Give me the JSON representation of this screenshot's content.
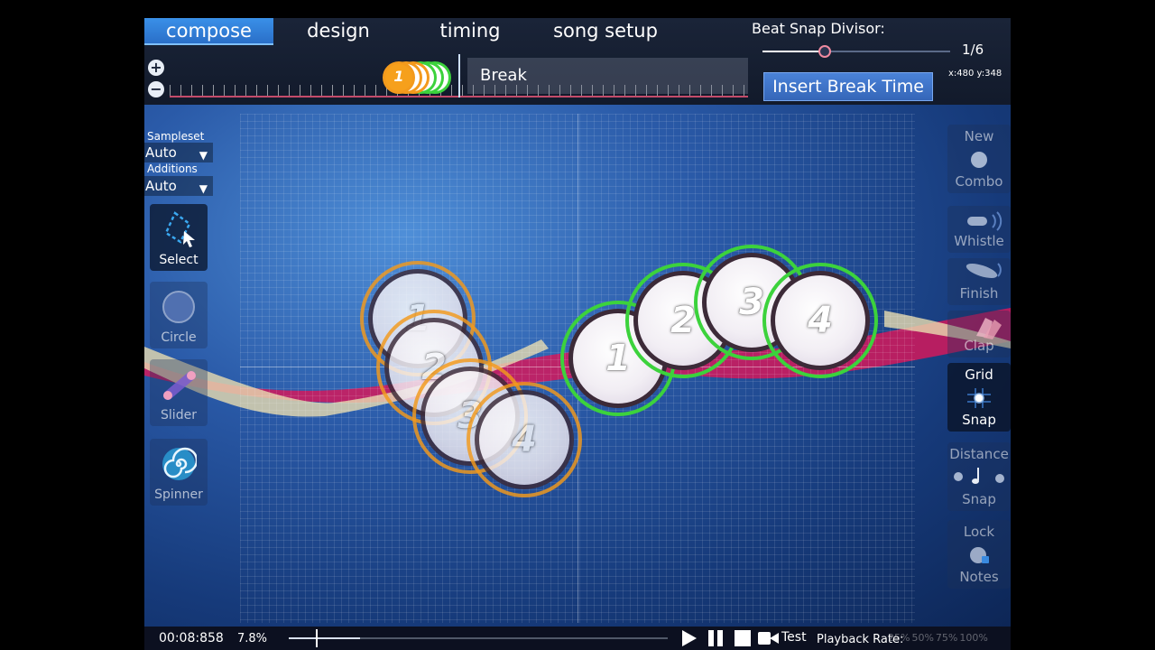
{
  "tabs": [
    {
      "label": "compose",
      "active": true
    },
    {
      "label": "design",
      "active": false
    },
    {
      "label": "timing",
      "active": false
    },
    {
      "label": "song setup",
      "active": false
    }
  ],
  "zoom": {
    "in_label": "+",
    "out_label": "−"
  },
  "timeline": {
    "break_label": "Break",
    "note_number": "1",
    "notes": [
      "orange",
      "orange",
      "orange",
      "green",
      "green",
      "green"
    ]
  },
  "beat_snap": {
    "label": "Beat Snap Divisor:",
    "value": "1/6",
    "level": 0.33
  },
  "coords": "x:480 y:348",
  "insert_break_label": "Insert Break Time",
  "left_panel": {
    "sampleset_label": "Sampleset",
    "sampleset_value": "Auto",
    "additions_label": "Additions",
    "additions_value": "Auto",
    "tools": [
      {
        "name": "select",
        "label": "Select",
        "icon": "select-icon",
        "active": true
      },
      {
        "name": "circle",
        "label": "Circle",
        "icon": "circle-icon",
        "active": false
      },
      {
        "name": "slider",
        "label": "Slider",
        "icon": "slider-icon",
        "active": false
      },
      {
        "name": "spinner",
        "label": "Spinner",
        "icon": "spinner-icon",
        "active": false
      }
    ]
  },
  "right_panel": {
    "new_combo": {
      "top": "New",
      "bottom": "Combo"
    },
    "whistle": "Whistle",
    "finish": "Finish",
    "clap": "Clap",
    "grid_snap": {
      "top": "Grid",
      "bottom": "Snap",
      "active": true
    },
    "distance_snap": {
      "top": "Distance",
      "bottom": "Snap"
    },
    "lock_notes": {
      "top": "Lock",
      "bottom": "Notes"
    }
  },
  "hit_objects": {
    "orange_combo": [
      "1",
      "2",
      "3",
      "4"
    ],
    "green_combo": [
      "1",
      "2",
      "3",
      "4"
    ]
  },
  "bottom_bar": {
    "time": "00:08:858",
    "percent": "7.8%",
    "progress": 0.078,
    "test_label": "Test",
    "playback_label": "Playback Rate:",
    "rates": [
      "25%",
      "50%",
      "75%",
      "100%"
    ]
  },
  "colors": {
    "accent_tab": "#3a90e8",
    "combo_orange": "#f39a1c",
    "combo_green": "#3cd23c",
    "ribbon_pink": "#d4195c",
    "ribbon_cream": "#e8dcb0"
  }
}
